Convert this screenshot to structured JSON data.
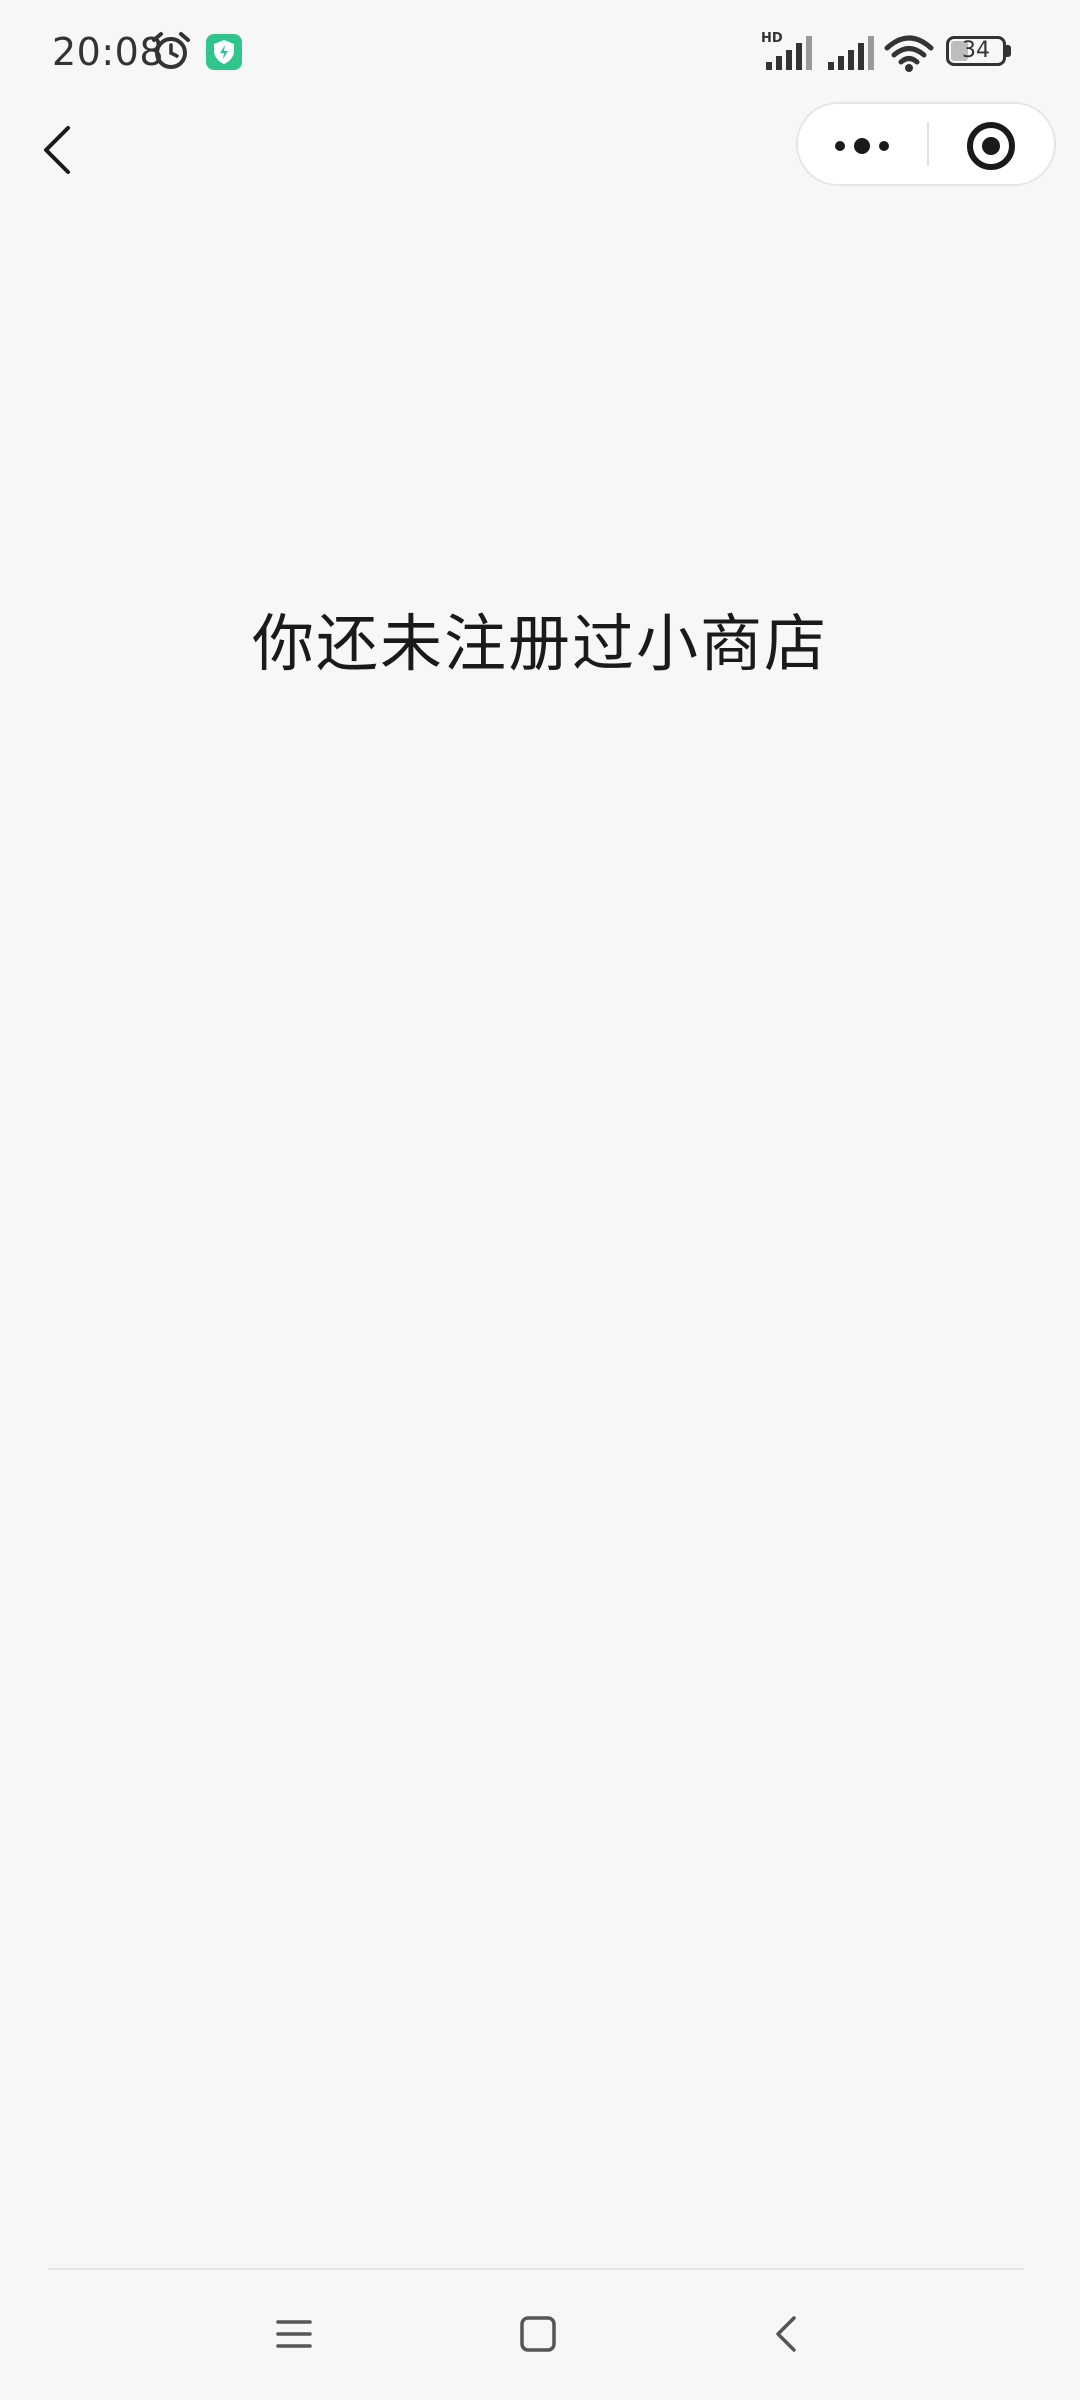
{
  "status_bar": {
    "time": "20:08",
    "battery_level": "34",
    "hd_label": "HD",
    "icons": [
      "alarm-icon",
      "shield-icon",
      "hd-signal-icon",
      "signal-icon",
      "wifi-icon",
      "battery-icon"
    ],
    "shield_color": "#2fc58c"
  },
  "nav_bar": {
    "back_icon": "chevron-left-icon",
    "more_icon": "more-dots-icon",
    "close_icon": "target-close-icon"
  },
  "main": {
    "message": "你还未注册过小商店"
  },
  "system_nav": {
    "icons": [
      "menu-icon",
      "home-square-icon",
      "back-chevron-icon"
    ]
  },
  "colors": {
    "background": "#f7f7f7",
    "text": "#1a1a1a"
  }
}
